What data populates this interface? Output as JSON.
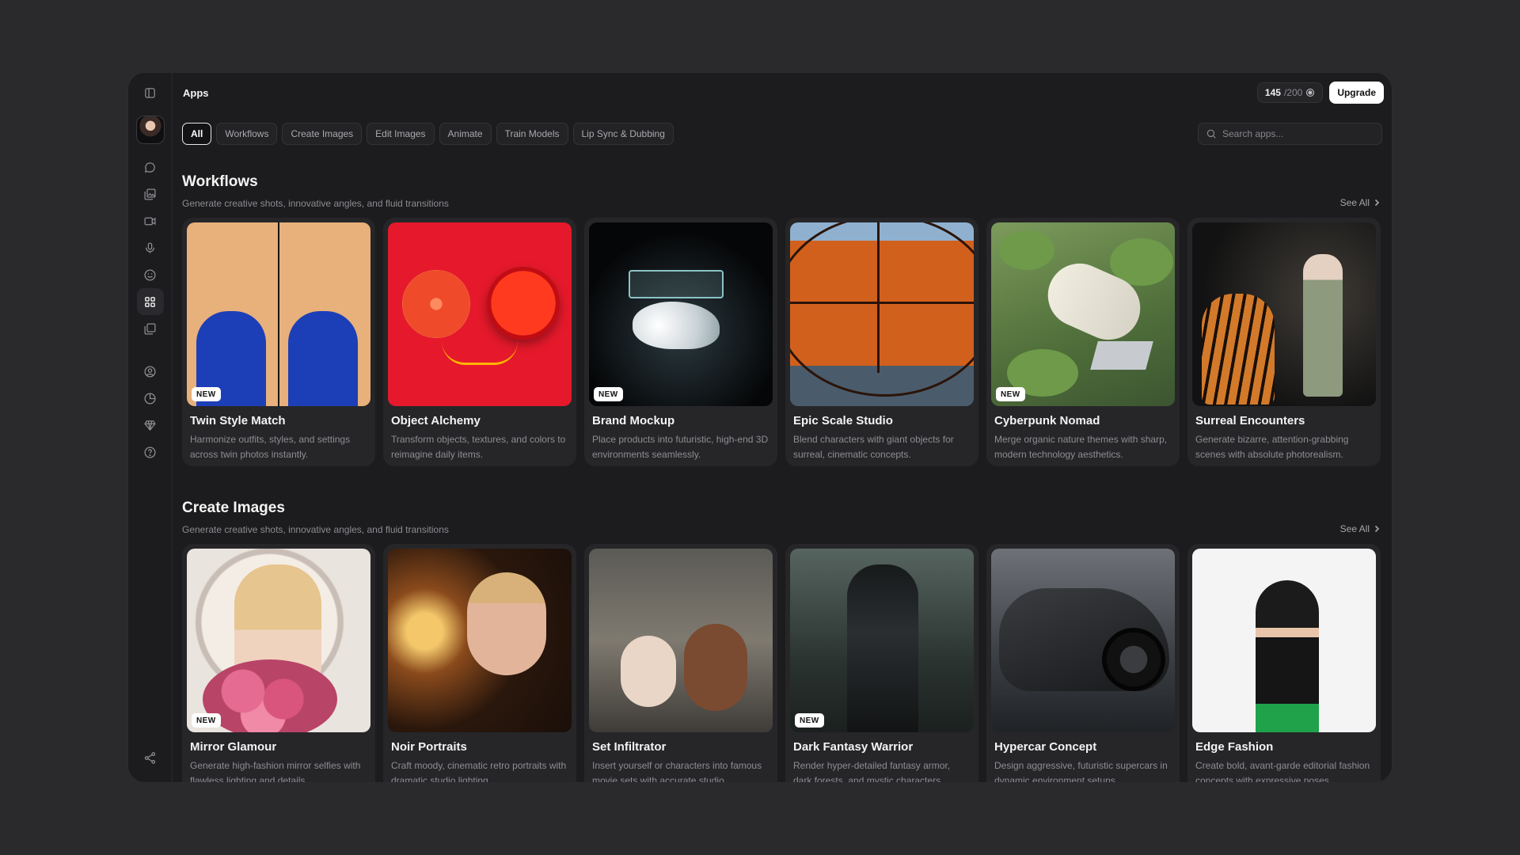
{
  "sidebar": {
    "icons": [
      "panel-toggle-icon",
      "chat-icon",
      "images-icon",
      "video-icon",
      "microphone-icon",
      "emoji-icon",
      "apps-grid-icon",
      "gallery-icon",
      "user-circle-icon",
      "history-icon",
      "diamond-icon",
      "help-icon",
      "share-icon"
    ],
    "active": "apps-grid-icon"
  },
  "header": {
    "title": "Apps",
    "credits_used": "145",
    "credits_total": "/200",
    "upgrade_label": "Upgrade"
  },
  "filters": [
    "All",
    "Workflows",
    "Create Images",
    "Edit Images",
    "Animate",
    "Train Models",
    "Lip Sync & Dubbing"
  ],
  "search": {
    "placeholder": "Search apps..."
  },
  "sections": [
    {
      "title": "Workflows",
      "subtitle": "Generate creative shots, innovative angles, and fluid transitions",
      "see_all": "See All",
      "cards": [
        {
          "title": "Twin Style Match",
          "desc": "Harmonize outfits, styles, and settings across twin photos instantly.",
          "badge": "NEW"
        },
        {
          "title": "Object Alchemy",
          "desc": "Transform objects, textures, and colors to reimagine daily items.",
          "badge": ""
        },
        {
          "title": "Brand Mockup",
          "desc": "Place products into futuristic, high-end 3D environments seamlessly.",
          "badge": "NEW"
        },
        {
          "title": "Epic Scale Studio",
          "desc": "Blend characters with giant objects for surreal, cinematic concepts.",
          "badge": ""
        },
        {
          "title": "Cyberpunk Nomad",
          "desc": "Merge organic nature themes with sharp, modern technology aesthetics.",
          "badge": "NEW"
        },
        {
          "title": "Surreal Encounters",
          "desc": "Generate bizarre, attention-grabbing scenes with absolute photorealism.",
          "badge": ""
        }
      ]
    },
    {
      "title": "Create Images",
      "subtitle": "Generate creative shots, innovative angles, and fluid transitions",
      "see_all": "See All",
      "cards": [
        {
          "title": "Mirror Glamour",
          "desc": "Generate high-fashion mirror selfies with flawless lighting and details.",
          "badge": "NEW"
        },
        {
          "title": "Noir Portraits",
          "desc": "Craft moody, cinematic retro portraits with dramatic studio lighting.",
          "badge": ""
        },
        {
          "title": "Set Infiltrator",
          "desc": " Insert yourself or characters into famous movie sets with accurate studio.",
          "badge": ""
        },
        {
          "title": "Dark Fantasy Warrior",
          "desc": "Render hyper-detailed fantasy armor, dark forests, and mystic characters.",
          "badge": "NEW"
        },
        {
          "title": "Hypercar Concept",
          "desc": "Design aggressive, futuristic supercars in dynamic environment setups.",
          "badge": ""
        },
        {
          "title": "Edge Fashion",
          "desc": "Create bold, avant-garde editorial fashion concepts with expressive poses.",
          "badge": ""
        }
      ]
    }
  ]
}
